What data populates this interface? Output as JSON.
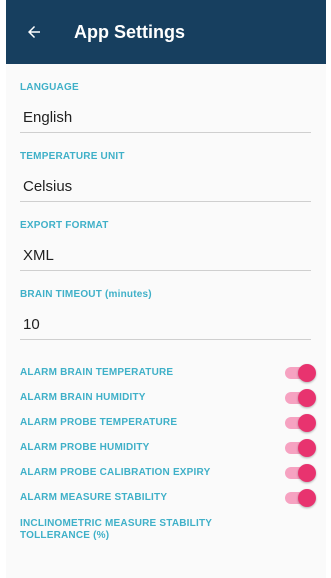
{
  "header": {
    "title": "App Settings",
    "back_icon": "arrow-left-icon"
  },
  "colors": {
    "appbar": "#173f5f",
    "label": "#3fb0c8",
    "toggle_on": "#e8336f"
  },
  "fields": [
    {
      "label": "LANGUAGE",
      "value": "English"
    },
    {
      "label": "TEMPERATURE UNIT",
      "value": "Celsius"
    },
    {
      "label": "EXPORT FORMAT",
      "value": "XML"
    },
    {
      "label": "BRAIN TIMEOUT (minutes)",
      "value": "10"
    }
  ],
  "toggles": [
    {
      "label": "ALARM BRAIN TEMPERATURE",
      "on": true
    },
    {
      "label": "ALARM BRAIN HUMIDITY",
      "on": true
    },
    {
      "label": "ALARM PROBE TEMPERATURE",
      "on": true
    },
    {
      "label": "ALARM PROBE HUMIDITY",
      "on": true
    },
    {
      "label": "ALARM PROBE CALIBRATION EXPIRY",
      "on": true
    },
    {
      "label": "ALARM MEASURE STABILITY",
      "on": true
    }
  ],
  "footer_label": "INCLINOMETRIC MEASURE STABILITY TOLLERANCE (%)"
}
